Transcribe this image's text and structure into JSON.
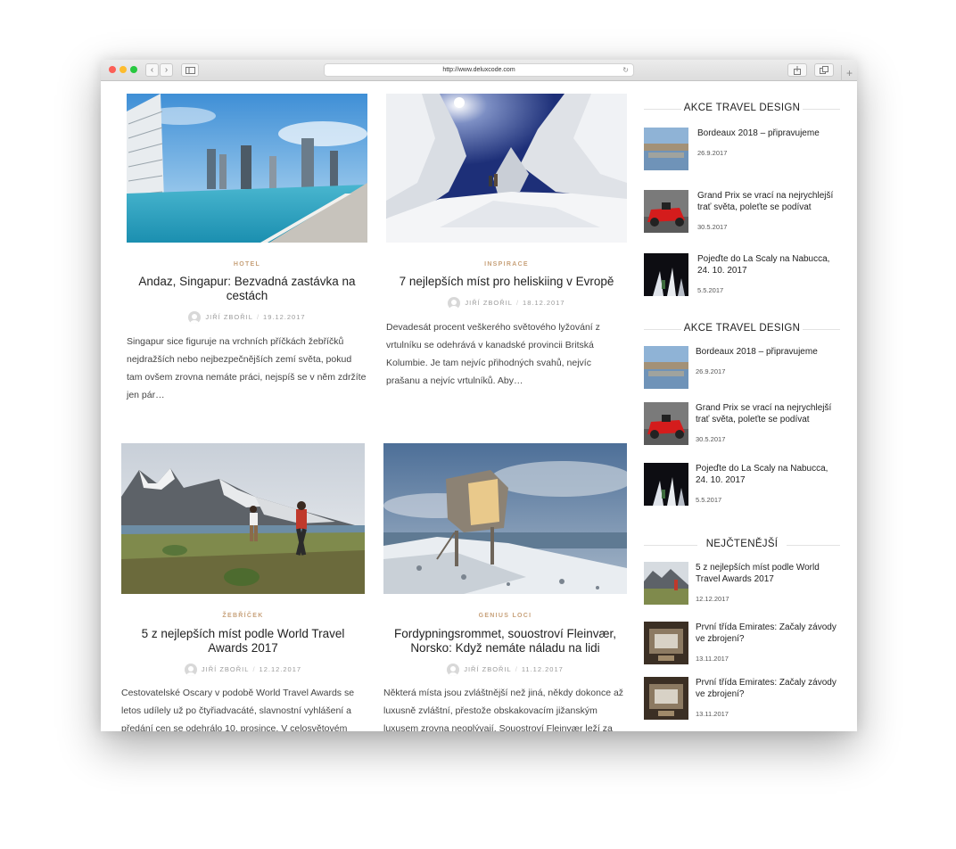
{
  "browser": {
    "url": "http://www.deluxcode.com",
    "reload_icon": "reload-icon",
    "back_icon": "chevron-left-icon",
    "forward_icon": "chevron-right-icon",
    "sidebar_icon": "sidebar-icon",
    "share_icon": "share-icon",
    "tabs_icon": "tabs-icon",
    "new_tab": "+"
  },
  "posts": [
    {
      "category": "HOTEL",
      "title": "Andaz, Singapur: Bezvadná zastávka na cestách",
      "author": "JIŘÍ ZBOŘIL",
      "date": "19.12.2017",
      "excerpt": "Singapur sice figuruje na vrchních příčkách žebříčků nejdražších nebo nejbezpečnějších zemí světa, pokud tam ovšem zrovna nemáte práci, nejspíš se v něm zdržíte jen pár…"
    },
    {
      "category": "INSPIRACE",
      "title": "7 nejlepších míst pro heliskiing v Evropě",
      "author": "JIŘÍ ZBOŘIL",
      "date": "18.12.2017",
      "excerpt": "Devadesát procent veškerého světového lyžování z vrtulníku se odehrává v kanadské provincii Britská Kolumbie. Je tam nejvíc přihodných svahů, nejvíc prašanu a nejvíc vrtulníků. Aby…"
    },
    {
      "category": "ŽEBŘÍČEK",
      "title": "5 z nejlepších míst podle World Travel Awards 2017",
      "author": "JIŘÍ ZBOŘIL",
      "date": "12.12.2017",
      "excerpt": "Cestovatelské Oscary v podobě World Travel Awards se letos udílely už po čtyřiadvacáté, slavnostní vyhlášení a předání cen se odehrálo 10. prosince. V celosvětovém"
    },
    {
      "category": "GENIUS LOCI",
      "title": "Fordypningsrommet, souostroví Fleinvær, Norsko: Když nemáte náladu na lidi",
      "author": "JIŘÍ ZBOŘIL",
      "date": "11.12.2017",
      "excerpt": "Některá místa jsou zvláštnější než jiná, někdy dokonce až luxusně zvláštní, přestože obskakovacím jižanským luxusem zrovna neoplývají. Souostroví Fleinvær leží za"
    }
  ],
  "sidebar": {
    "widget1": {
      "title": "AKCE TRAVEL DESIGN",
      "items": [
        {
          "title": "Bordeaux 2018 – připravujeme",
          "date": "26.9.2017"
        },
        {
          "title": "Grand Prix se vrací na nejrychlejší trať světa, poleťte se podívat",
          "date": "30.5.2017"
        },
        {
          "title": "Pojeďte do La Scaly na Nabucca, 24. 10. 2017",
          "date": "5.5.2017"
        }
      ]
    },
    "widget2": {
      "title": "AKCE TRAVEL DESIGN",
      "items": [
        {
          "title": "Bordeaux 2018 – připravujeme",
          "date": "26.9.2017"
        },
        {
          "title": "Grand Prix se vrací na nejrychlejší trať světa, poleťte se podívat",
          "date": "30.5.2017"
        },
        {
          "title": "Pojeďte do La Scaly na Nabucca, 24. 10. 2017",
          "date": "5.5.2017"
        }
      ]
    },
    "widget3": {
      "title": "NEJČTENĚJŠÍ",
      "items": [
        {
          "title": "5 z nejlepších míst podle World Travel Awards 2017",
          "date": "12.12.2017"
        },
        {
          "title": "První třída Emirates: Začaly závody ve zbrojení?",
          "date": "13.11.2017"
        },
        {
          "title": "První třída Emirates: Začaly závody ve zbrojení?",
          "date": "13.11.2017"
        }
      ]
    }
  }
}
